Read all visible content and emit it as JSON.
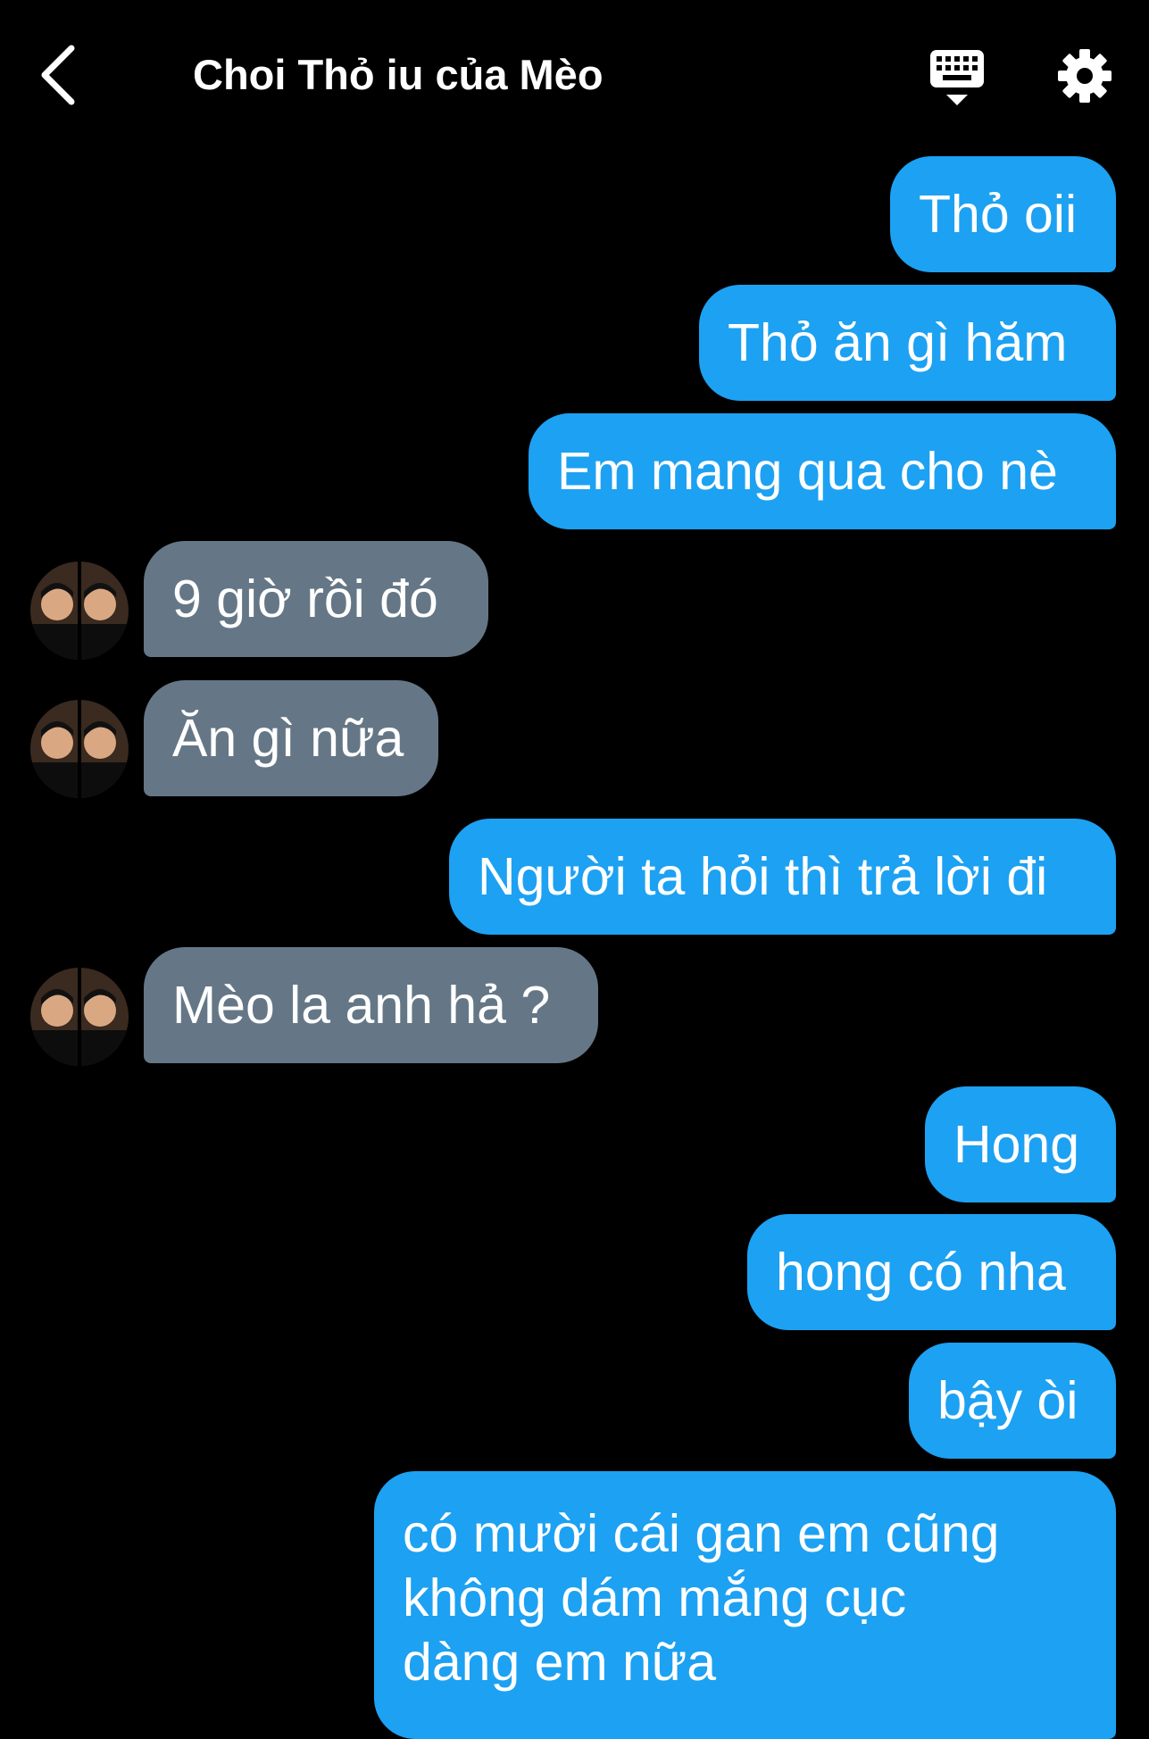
{
  "header": {
    "title": "Choi Thỏ iu của Mèo",
    "back_icon": "chevron-left-icon",
    "keyboard_icon": "keyboard-icon",
    "settings_icon": "gear-icon"
  },
  "colors": {
    "background": "#000000",
    "outgoing_bubble": "#1DA1F2",
    "incoming_bubble": "#657786",
    "text": "#FFFFFF"
  },
  "messages": [
    {
      "direction": "outgoing",
      "text": "Thỏ oii"
    },
    {
      "direction": "outgoing",
      "text": "Thỏ ăn gì hăm"
    },
    {
      "direction": "outgoing",
      "text": "Em mang qua cho nè"
    },
    {
      "direction": "incoming",
      "text": "9 giờ rồi đó",
      "avatar": "avatar"
    },
    {
      "direction": "incoming",
      "text": "Ăn gì nữa",
      "avatar": "avatar"
    },
    {
      "direction": "outgoing",
      "text": "Người ta hỏi thì trả lời đi"
    },
    {
      "direction": "incoming",
      "text": "Mèo la anh hả ?",
      "avatar": "avatar"
    },
    {
      "direction": "outgoing",
      "text": "Hong"
    },
    {
      "direction": "outgoing",
      "text": "hong có nha"
    },
    {
      "direction": "outgoing",
      "text": "bậy òi"
    },
    {
      "direction": "outgoing",
      "lines": [
        "có mười cái gan em cũng",
        "không dám mắng cục",
        "dàng em nữa"
      ]
    }
  ]
}
